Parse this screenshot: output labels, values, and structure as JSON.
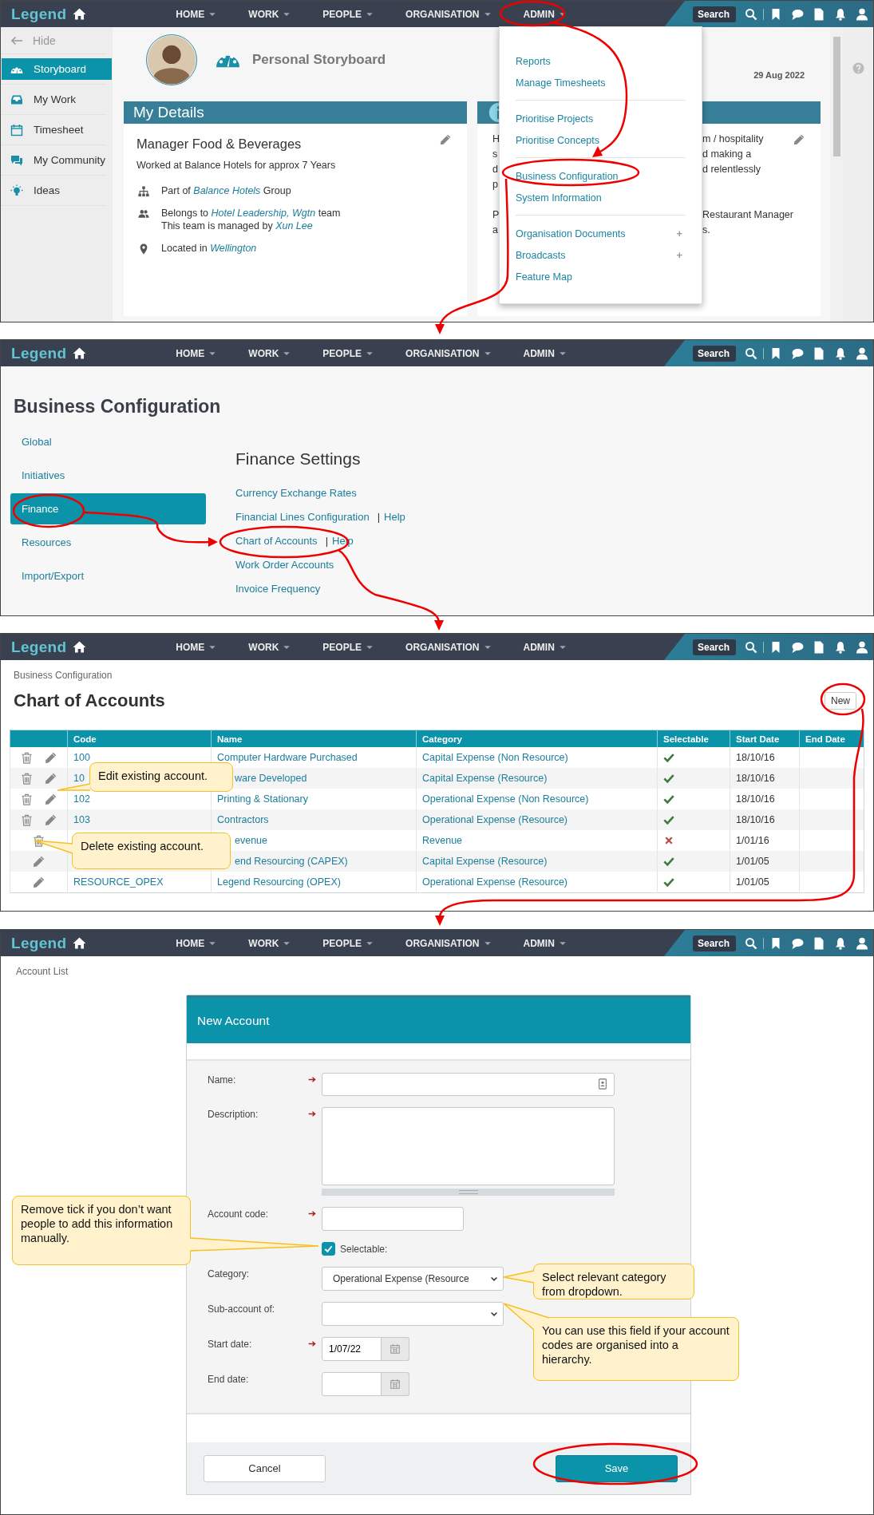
{
  "screens": [
    {
      "kind": "storyboard",
      "nav": {
        "logo": "Legend",
        "items": [
          "HOME",
          "WORK",
          "PEOPLE",
          "ORGANISATION",
          "ADMIN"
        ],
        "search": {
          "placeholder": "Search"
        }
      },
      "sidebar": {
        "hide": "Hide",
        "items": [
          {
            "label": "Storyboard",
            "selected": true
          },
          {
            "label": "My Work",
            "selected": false
          },
          {
            "label": "Timesheet",
            "selected": false
          },
          {
            "label": "My Community",
            "selected": false
          },
          {
            "label": "Ideas",
            "selected": false
          }
        ]
      },
      "header": {
        "title": "Personal Storyboard",
        "date": "29 Aug 2022"
      },
      "details_card": {
        "title": "My Details",
        "role": "Manager Food & Beverages",
        "tenure": "Worked at Balance Hotels for approx 7 Years",
        "facts": [
          {
            "lines": [
              {
                "before": "Part of ",
                "link": "Balance Hotels",
                "after": " Group"
              }
            ]
          },
          {
            "lines": [
              {
                "before": "Belongs to ",
                "link": "Hotel Leadership, Wgtn",
                "after": " team"
              },
              {
                "before": "This team is managed by ",
                "link": "Xun Lee"
              }
            ]
          },
          {
            "lines": [
              {
                "before": "Located in ",
                "link": "Wellington"
              }
            ]
          }
        ]
      },
      "about_card": {
        "paragraphs": [
          {
            "left": [
              "H",
              "s",
              "d",
              "p"
            ],
            "right": [
              "m / hospitality",
              "d making a",
              "d relentlessly"
            ]
          },
          {
            "left": [
              "P",
              "a"
            ],
            "right": [
              "Restaurant Manager",
              "s."
            ]
          }
        ]
      },
      "menu": {
        "sections": [
          {
            "items": [
              {
                "label": "Reports"
              },
              {
                "label": "Manage Timesheets"
              }
            ]
          },
          {
            "items": [
              {
                "label": "Prioritise Projects"
              },
              {
                "label": "Prioritise Concepts"
              }
            ]
          },
          {
            "items": [
              {
                "label": "Business Configuration"
              },
              {
                "label": "System Information"
              }
            ]
          },
          {
            "items": [
              {
                "label": "Organisation Documents",
                "expand": "+"
              },
              {
                "label": "Broadcasts",
                "expand": "+"
              },
              {
                "label": "Feature Map"
              }
            ]
          }
        ]
      }
    },
    {
      "kind": "business_configuration",
      "nav": {
        "logo": "Legend",
        "items": [
          "HOME",
          "WORK",
          "PEOPLE",
          "ORGANISATION",
          "ADMIN"
        ],
        "search": {
          "placeholder": "Search"
        }
      },
      "title": "Business Configuration",
      "menu": [
        {
          "label": "Global",
          "selected": false
        },
        {
          "label": "Initiatives",
          "selected": false
        },
        {
          "label": "Finance",
          "selected": true
        },
        {
          "label": "Resources",
          "selected": false
        },
        {
          "label": "Import/Export",
          "selected": false
        }
      ],
      "section_title": "Finance Settings",
      "links": [
        {
          "label": "Currency Exchange Rates"
        },
        {
          "label": "Financial Lines Configuration",
          "separator": "|",
          "help": "Help"
        },
        {
          "label": "Chart of Accounts",
          "separator": "|",
          "help": "Help"
        },
        {
          "label": "Work Order Accounts"
        },
        {
          "label": "Invoice Frequency"
        }
      ]
    },
    {
      "kind": "chart_of_accounts",
      "nav": {
        "logo": "Legend",
        "items": [
          "HOME",
          "WORK",
          "PEOPLE",
          "ORGANISATION",
          "ADMIN"
        ],
        "search": {
          "placeholder": "Search"
        }
      },
      "breadcrumb": "Business Configuration",
      "title": "Chart of Accounts",
      "new_button": "New",
      "table": {
        "columns": [
          "Code",
          "Name",
          "Category",
          "Selectable",
          "Start Date",
          "End Date"
        ],
        "rows": [
          {
            "delete_icon": true,
            "edit_icon": true,
            "code": "100",
            "name": "Computer Hardware Purchased",
            "category": "Capital Expense (Non Resource)",
            "selectable": true,
            "start_date": "18/10/16"
          },
          {
            "delete_icon": true,
            "edit_icon": true,
            "code": "10",
            "name": "ware Developed",
            "name_covered": true,
            "category": "Capital Expense (Resource)",
            "selectable": true,
            "start_date": "18/10/16"
          },
          {
            "delete_icon": true,
            "edit_icon": true,
            "code": "102",
            "name": "Printing & Stationary",
            "name_covered": false,
            "category": "Operational Expense (Non Resource)",
            "selectable": true,
            "start_date": "18/10/16"
          },
          {
            "delete_icon": true,
            "edit_icon": true,
            "code": "103",
            "name": "Contractors",
            "name_covered": false,
            "category": "Operational Expense (Resource)",
            "selectable": true,
            "start_date": "18/10/16"
          },
          {
            "delete_icon": true,
            "edit_icon": false,
            "name": "evenue",
            "name_covered": true,
            "category": "Revenue",
            "selectable": false,
            "start_date": "1/01/16"
          },
          {
            "delete_icon": false,
            "edit_icon": true,
            "name": "end Resourcing (CAPEX)",
            "name_covered": true,
            "category": "Capital Expense (Resource)",
            "selectable": true,
            "start_date": "1/01/05"
          },
          {
            "delete_icon": false,
            "edit_icon": true,
            "code": "RESOURCE_OPEX",
            "name": "Legend Resourcing (OPEX)",
            "name_covered": false,
            "category": "Operational Expense (Resource)",
            "selectable": true,
            "start_date": "1/01/05"
          }
        ]
      },
      "callouts": [
        {
          "text": "Edit existing account."
        },
        {
          "text": "Delete existing account."
        }
      ]
    },
    {
      "kind": "new_account",
      "nav": {
        "logo": "Legend",
        "items": [
          "HOME",
          "WORK",
          "PEOPLE",
          "ORGANISATION",
          "ADMIN"
        ],
        "search": {
          "placeholder": "Search"
        }
      },
      "breadcrumb": "Account List",
      "form": {
        "title": "New Account",
        "fields": [
          {
            "kind": "text",
            "label": "Name:",
            "required": true
          },
          {
            "kind": "textarea",
            "label": "Description:",
            "required": true
          },
          {
            "kind": "short_text",
            "label": "Account code:",
            "required": true
          },
          {
            "kind": "checkbox",
            "label": "Selectable:",
            "checked": true,
            "required": false
          },
          {
            "kind": "select",
            "label": "Category:",
            "value": "Operational Expense (Resource",
            "required": false
          },
          {
            "kind": "select",
            "label": "Sub-account of:",
            "required": false
          },
          {
            "kind": "date",
            "label": "Start date:",
            "value": "1/07/22",
            "required": true
          },
          {
            "kind": "date",
            "label": "End date:",
            "required": false
          }
        ],
        "buttons": [
          {
            "label": "Cancel",
            "kind": "secondary"
          },
          {
            "label": "Save",
            "kind": "primary"
          }
        ]
      },
      "callouts": [
        {
          "text": "Remove tick if you don’t want people to add this information manually."
        },
        {
          "text": "Select relevant category from dropdown."
        },
        {
          "text": "You can use this field if your account codes are organised into a hierarchy."
        }
      ]
    }
  ]
}
